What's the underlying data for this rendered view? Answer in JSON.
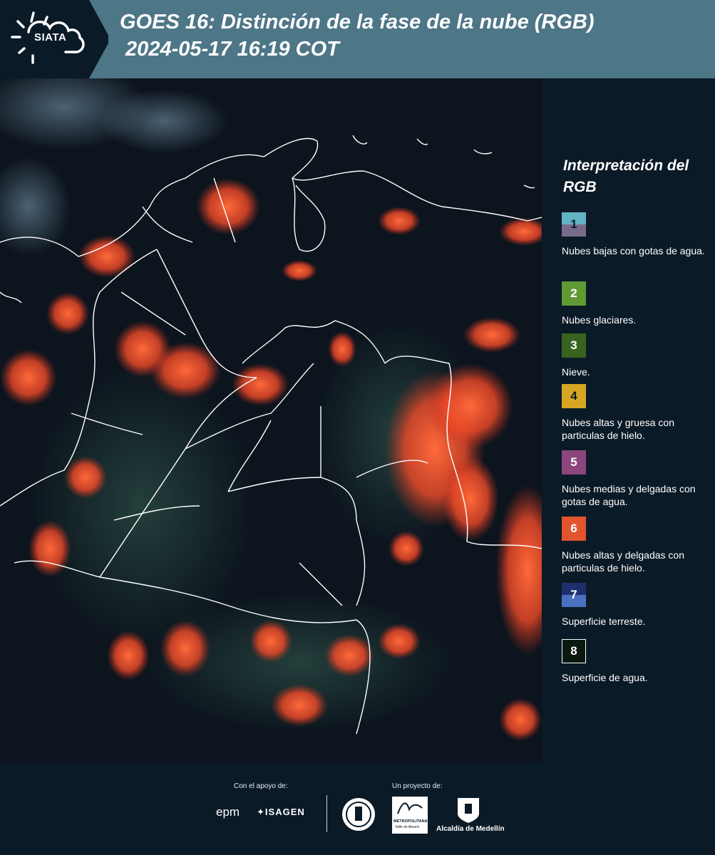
{
  "header": {
    "logo_text": "SIATA",
    "title_line1": "GOES 16: Distinción de la fase de la nube (RGB)",
    "title_line2": " 2024-05-17 16:19 COT"
  },
  "legend": {
    "title": "Interpretación del RGB",
    "items": [
      {
        "number": "1",
        "label": "Nubes bajas con gotas de agua.",
        "color_top": "#62b3c3",
        "color_bottom": "#7a6a8a"
      },
      {
        "number": "2",
        "label": "Nubes glaciares.",
        "color": "#5f9a34"
      },
      {
        "number": "3",
        "label": "Nieve.",
        "color": "#3a6320"
      },
      {
        "number": "4",
        "label": "Nubes altas y gruesa con particulas de hielo.",
        "color": "#d6a622"
      },
      {
        "number": "5",
        "label": "Nubes medias y delgadas con gotas de agua.",
        "color": "#8c467e"
      },
      {
        "number": "6",
        "label": "Nubes altas y delgadas con particulas de hielo.",
        "color": "#e2542e"
      },
      {
        "number": "7",
        "label": "Superficie terreste.",
        "color_top": "#1d2f6c",
        "color_bottom": "#4b70c2"
      },
      {
        "number": "8",
        "label": "Superficie de agua.",
        "color": "#0a1810"
      }
    ]
  },
  "footer": {
    "support_label": "Con el apoyo de:",
    "project_label": "Un proyecto de:",
    "sponsor1": "epm",
    "sponsor2": "ISAGEN",
    "partner1": "METROPOLITANA",
    "partner1_sub": "Valle de Aburrá",
    "partner2": "Alcaldía de Medellín"
  },
  "colors": {
    "header_bg": "#4d7687",
    "panel_bg": "#0b1a27",
    "cloud_red": "#ff5a30"
  }
}
